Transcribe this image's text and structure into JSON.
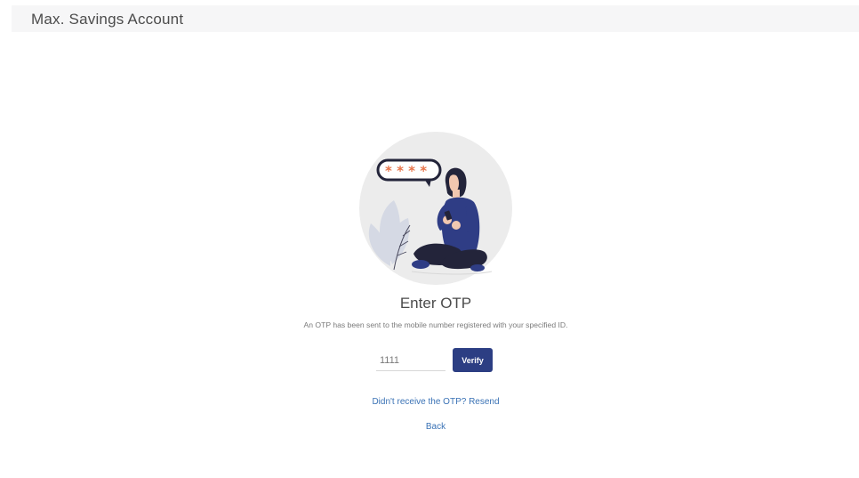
{
  "header": {
    "title": "Max. Savings Account"
  },
  "otp": {
    "title": "Enter OTP",
    "description": "An OTP has been sent to the mobile number registered with your specified ID.",
    "input_value": "1111",
    "verify_label": "Verify",
    "resend_label": "Didn't receive the OTP? Resend",
    "back_label": "Back"
  },
  "illustration": {
    "speech_bubble_text": "* * * *",
    "icon": "woman-with-phone-illustration"
  },
  "colors": {
    "primary": "#2c3e83",
    "link": "#3a72b5",
    "header_bg": "#f6f6f7",
    "accent_orange": "#e8744a"
  }
}
